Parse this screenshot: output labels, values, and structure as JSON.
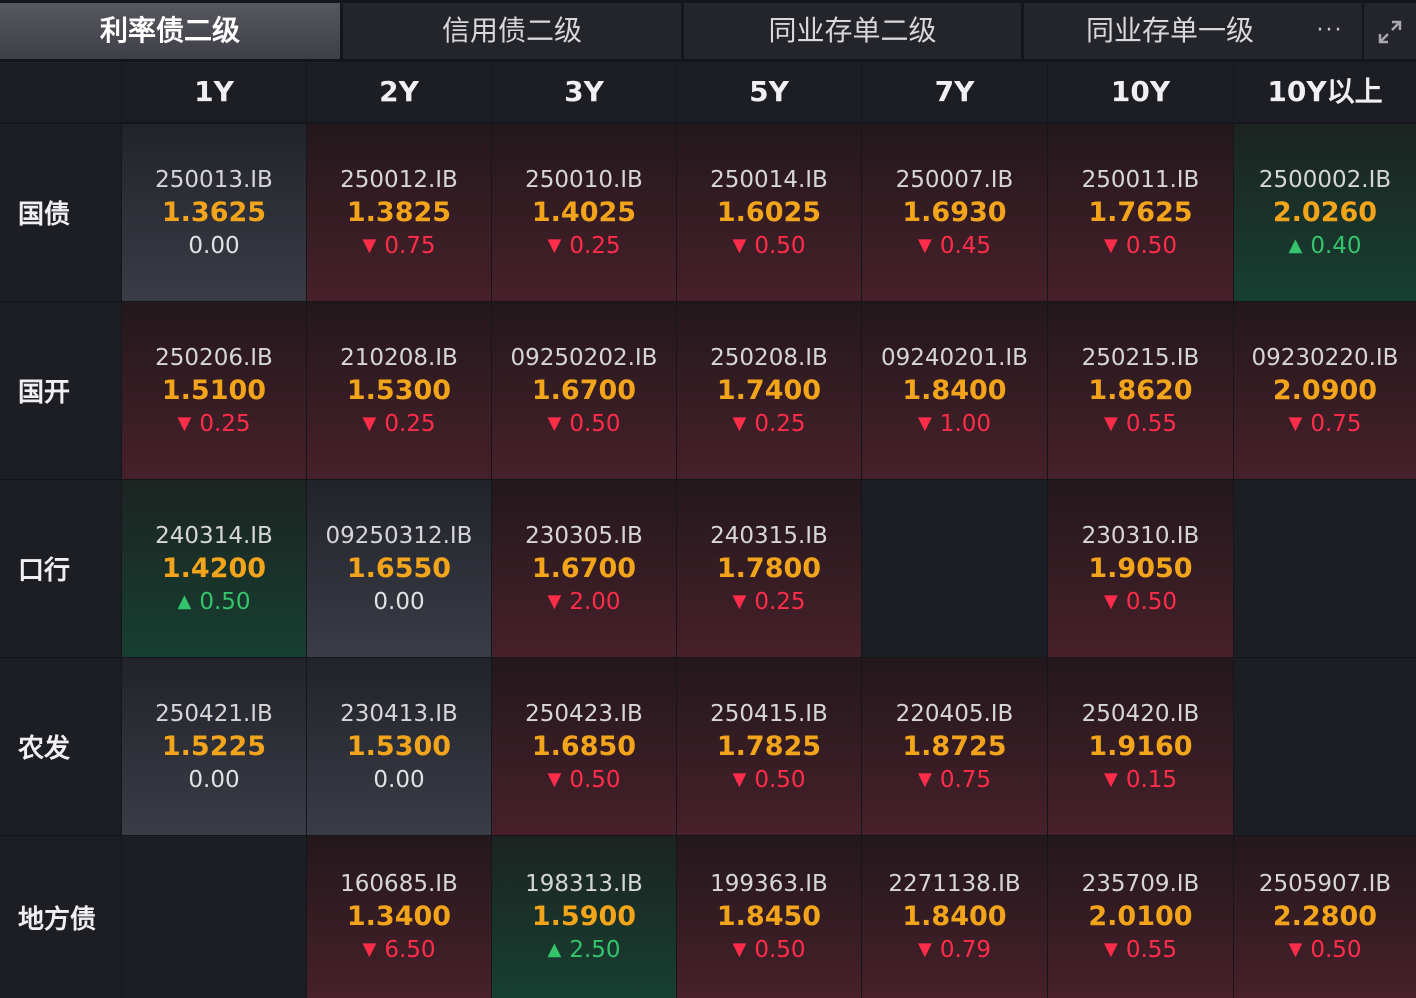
{
  "tabs": [
    "利率债二级",
    "信用债二级",
    "同业存单二级",
    "同业存单一级"
  ],
  "more_label": "···",
  "expand_icon": "expand-icon",
  "colors": {
    "accent": "#f2a41b",
    "up": "#35c46b",
    "down": "#ff2d4a"
  },
  "header": [
    "1Y",
    "2Y",
    "3Y",
    "5Y",
    "7Y",
    "10Y",
    "10Y以上"
  ],
  "rows": [
    {
      "label": "国债",
      "cells": [
        {
          "code": "250013.IB",
          "rate": "1.3625",
          "change": "0.00",
          "dir": "flat"
        },
        {
          "code": "250012.IB",
          "rate": "1.3825",
          "change": "0.75",
          "dir": "down"
        },
        {
          "code": "250010.IB",
          "rate": "1.4025",
          "change": "0.25",
          "dir": "down"
        },
        {
          "code": "250014.IB",
          "rate": "1.6025",
          "change": "0.50",
          "dir": "down"
        },
        {
          "code": "250007.IB",
          "rate": "1.6930",
          "change": "0.45",
          "dir": "down"
        },
        {
          "code": "250011.IB",
          "rate": "1.7625",
          "change": "0.50",
          "dir": "down"
        },
        {
          "code": "2500002.IB",
          "rate": "2.0260",
          "change": "0.40",
          "dir": "up"
        }
      ]
    },
    {
      "label": "国开",
      "cells": [
        {
          "code": "250206.IB",
          "rate": "1.5100",
          "change": "0.25",
          "dir": "down"
        },
        {
          "code": "210208.IB",
          "rate": "1.5300",
          "change": "0.25",
          "dir": "down"
        },
        {
          "code": "09250202.IB",
          "rate": "1.6700",
          "change": "0.50",
          "dir": "down"
        },
        {
          "code": "250208.IB",
          "rate": "1.7400",
          "change": "0.25",
          "dir": "down"
        },
        {
          "code": "09240201.IB",
          "rate": "1.8400",
          "change": "1.00",
          "dir": "down"
        },
        {
          "code": "250215.IB",
          "rate": "1.8620",
          "change": "0.55",
          "dir": "down"
        },
        {
          "code": "09230220.IB",
          "rate": "2.0900",
          "change": "0.75",
          "dir": "down"
        }
      ]
    },
    {
      "label": "口行",
      "cells": [
        {
          "code": "240314.IB",
          "rate": "1.4200",
          "change": "0.50",
          "dir": "up"
        },
        {
          "code": "09250312.IB",
          "rate": "1.6550",
          "change": "0.00",
          "dir": "flat"
        },
        {
          "code": "230305.IB",
          "rate": "1.6700",
          "change": "2.00",
          "dir": "down"
        },
        {
          "code": "240315.IB",
          "rate": "1.7800",
          "change": "0.25",
          "dir": "down"
        },
        null,
        {
          "code": "230310.IB",
          "rate": "1.9050",
          "change": "0.50",
          "dir": "down"
        },
        null
      ]
    },
    {
      "label": "农发",
      "cells": [
        {
          "code": "250421.IB",
          "rate": "1.5225",
          "change": "0.00",
          "dir": "flat"
        },
        {
          "code": "230413.IB",
          "rate": "1.5300",
          "change": "0.00",
          "dir": "flat"
        },
        {
          "code": "250423.IB",
          "rate": "1.6850",
          "change": "0.50",
          "dir": "down"
        },
        {
          "code": "250415.IB",
          "rate": "1.7825",
          "change": "0.50",
          "dir": "down"
        },
        {
          "code": "220405.IB",
          "rate": "1.8725",
          "change": "0.75",
          "dir": "down"
        },
        {
          "code": "250420.IB",
          "rate": "1.9160",
          "change": "0.15",
          "dir": "down"
        },
        null
      ]
    },
    {
      "label": "地方债",
      "cells": [
        null,
        {
          "code": "160685.IB",
          "rate": "1.3400",
          "change": "6.50",
          "dir": "down"
        },
        {
          "code": "198313.IB",
          "rate": "1.5900",
          "change": "2.50",
          "dir": "up"
        },
        {
          "code": "199363.IB",
          "rate": "1.8450",
          "change": "0.50",
          "dir": "down"
        },
        {
          "code": "2271138.IB",
          "rate": "1.8400",
          "change": "0.79",
          "dir": "down"
        },
        {
          "code": "235709.IB",
          "rate": "2.0100",
          "change": "0.55",
          "dir": "down"
        },
        {
          "code": "2505907.IB",
          "rate": "2.2800",
          "change": "0.50",
          "dir": "down"
        }
      ]
    }
  ]
}
